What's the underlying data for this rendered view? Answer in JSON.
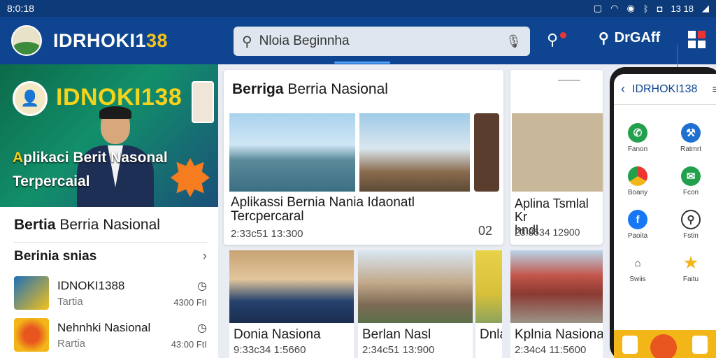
{
  "status_bar": {
    "time": "8:0:18",
    "right_text": "13 18"
  },
  "app": {
    "brand_prefix": "IDRHOKI1",
    "brand_suffix": "38"
  },
  "search": {
    "placeholder": "Nloia Beginnha"
  },
  "header": {
    "search_label": "DrGAff"
  },
  "hero": {
    "title": "IDNOKI138",
    "subtitle_a": "A",
    "subtitle_b": "plikaci Berit Nasonal",
    "subtitle_line2": "Terpercaial"
  },
  "left_panel": {
    "title_bold": "Bertia",
    "title_rest": " Berria Nasional",
    "section_title": "Berinia snias",
    "items": [
      {
        "name": "IDNOKI1388",
        "sub": "Tartia",
        "time": "4300 FtI"
      },
      {
        "name": "Nehnhki Nasional",
        "sub": "Rartia",
        "time": "43:00 FtI"
      }
    ]
  },
  "main_card": {
    "title_bold": "Berriga",
    "title_rest": " Berria Nasional",
    "caption_line1": "Aplikassi Bernia Nania Idaonatl",
    "caption_line2": "Tercpercaral",
    "date": "2:33c51 13:300",
    "count": "02"
  },
  "right_card": {
    "caption_line1": "Aplina Tsmlal Kr",
    "caption_line2": "hndl",
    "date": "23:8534 12900"
  },
  "grid": [
    {
      "caption": "Donia Nasiona",
      "date": "9:33c34 1:5660"
    },
    {
      "caption": "Berlan Nasl",
      "date": "2:34c51 13:900"
    },
    {
      "caption": "Dnla",
      "date": ""
    },
    {
      "caption": "Kplnia Nasionad",
      "date": "2:34c4 11:5600"
    }
  ],
  "phone": {
    "title": "IDRHOKI138",
    "apps": [
      "Fanon",
      "Ratmrt",
      "Boany",
      "Fcon",
      "Paoita",
      "Fstin",
      "Swiis",
      "Faitu"
    ]
  },
  "colors": {
    "primary": "#0f4590",
    "accent": "#f5c21b",
    "alert": "#e33333"
  }
}
